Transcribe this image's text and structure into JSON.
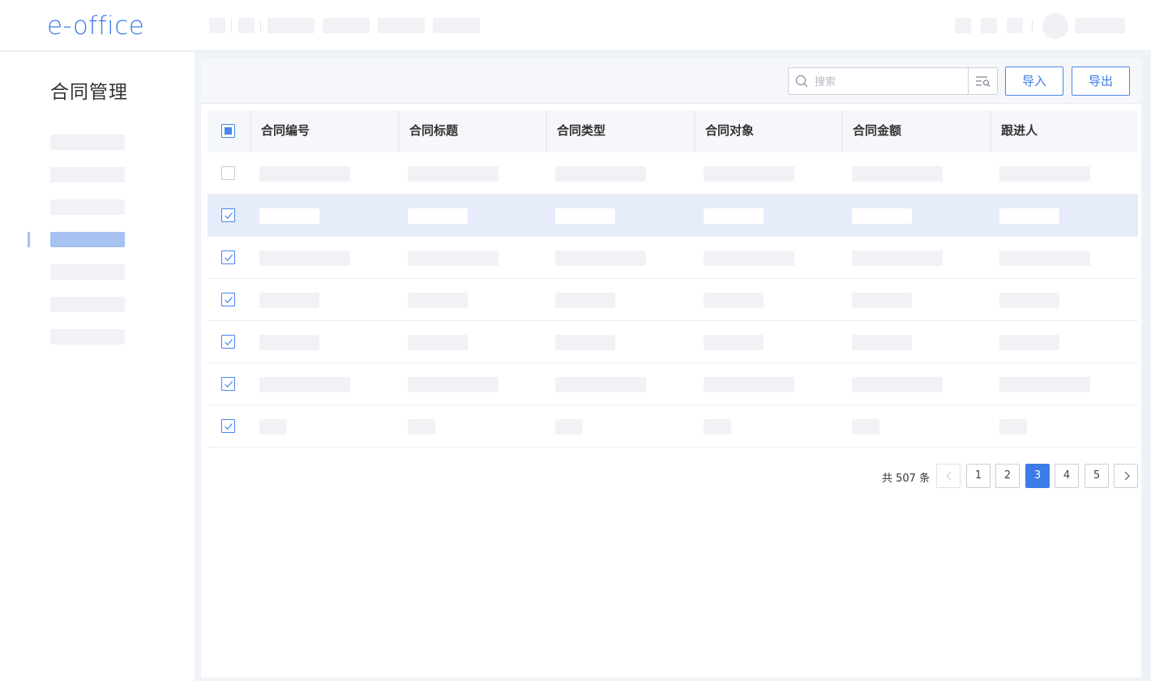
{
  "header": {
    "logo": "e-office"
  },
  "sidebar": {
    "title": "合同管理",
    "active_index": 3
  },
  "toolbar": {
    "search_placeholder": "搜索",
    "import_label": "导入",
    "export_label": "导出"
  },
  "table": {
    "columns": [
      "合同编号",
      "合同标题",
      "合同类型",
      "合同对象",
      "合同金额",
      "跟进人"
    ],
    "rows": [
      {
        "checked": false,
        "selected": false
      },
      {
        "checked": true,
        "selected": true
      },
      {
        "checked": true,
        "selected": false
      },
      {
        "checked": true,
        "selected": false
      },
      {
        "checked": true,
        "selected": false
      },
      {
        "checked": true,
        "selected": false
      },
      {
        "checked": true,
        "selected": false
      }
    ]
  },
  "pagination": {
    "total_label": "共 507 条",
    "pages": [
      "1",
      "2",
      "3",
      "4",
      "5"
    ],
    "current": "3"
  },
  "colors": {
    "accent": "#3d7ce8",
    "selected_row": "#e6ecf9",
    "skeleton": "#f1f2f5"
  },
  "icons": [
    "search-icon",
    "filter-search-icon",
    "chevron-left-icon",
    "chevron-right-icon",
    "checkbox-checked-icon"
  ]
}
